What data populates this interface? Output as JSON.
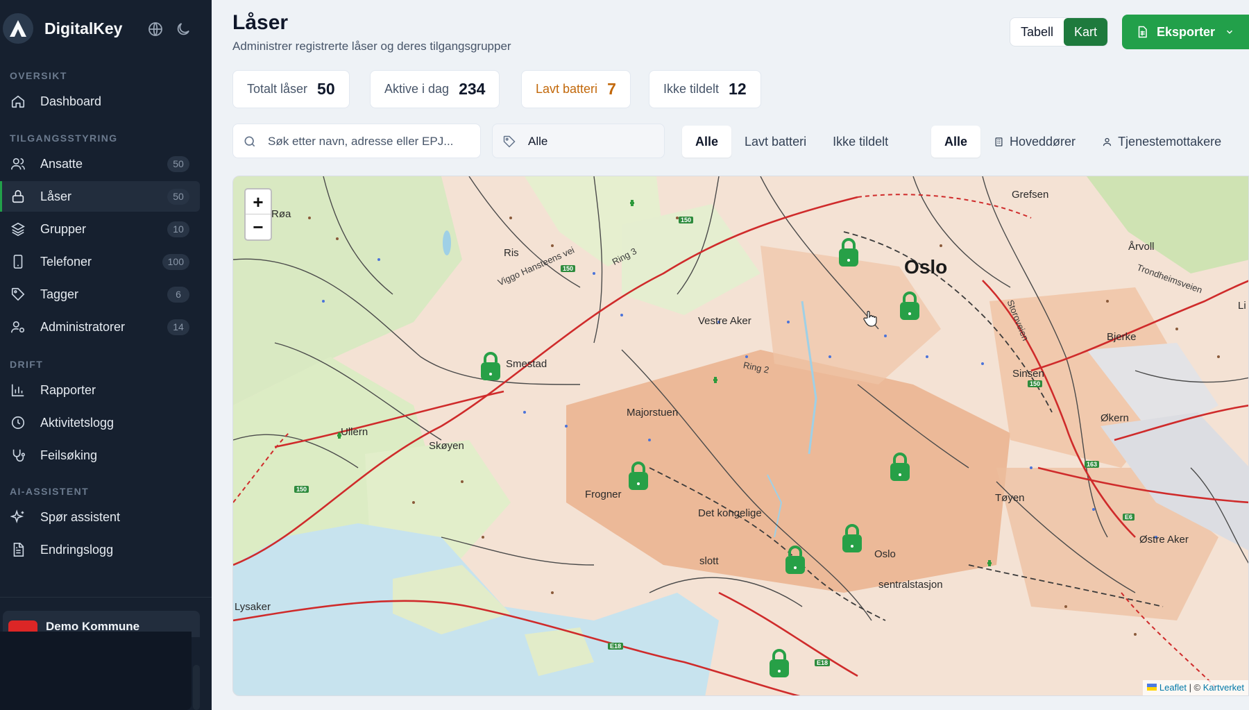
{
  "brand": {
    "name": "DigitalKey",
    "logo_letter": "A"
  },
  "colors": {
    "sidebar_bg": "#16202f",
    "accent_green": "#22a04a",
    "dark_green": "#1e7a3d",
    "warning": "#c2680a",
    "marker": "#27a047"
  },
  "sidebar": {
    "sections": [
      {
        "label": "OVERSIKT",
        "items": [
          {
            "label": "Dashboard",
            "icon": "home-icon",
            "badge": ""
          }
        ]
      },
      {
        "label": "TILGANGSSTYRING",
        "items": [
          {
            "label": "Ansatte",
            "icon": "users-icon",
            "badge": "50"
          },
          {
            "label": "Låser",
            "icon": "lock-icon",
            "badge": "50",
            "active": true
          },
          {
            "label": "Grupper",
            "icon": "layers-icon",
            "badge": "10"
          },
          {
            "label": "Telefoner",
            "icon": "phone-icon",
            "badge": "100"
          },
          {
            "label": "Tagger",
            "icon": "tag-icon",
            "badge": "6"
          },
          {
            "label": "Administratorer",
            "icon": "user-cog-icon",
            "badge": "14"
          }
        ]
      },
      {
        "label": "DRIFT",
        "items": [
          {
            "label": "Rapporter",
            "icon": "bar-chart-icon",
            "badge": ""
          },
          {
            "label": "Aktivitetslogg",
            "icon": "clock-icon",
            "badge": ""
          },
          {
            "label": "Feilsøking",
            "icon": "stethoscope-icon",
            "badge": ""
          }
        ]
      },
      {
        "label": "AI-ASSISTENT",
        "items": [
          {
            "label": "Spør assistent",
            "icon": "sparkles-icon",
            "badge": ""
          },
          {
            "label": "Endringslogg",
            "icon": "file-text-icon",
            "badge": ""
          }
        ]
      }
    ],
    "org": {
      "name": "Demo Kommune",
      "avatar": "DK"
    }
  },
  "header": {
    "title": "Låser",
    "subtitle": "Administrer registrerte låser og deres tilgangsgrupper",
    "view_toggle": {
      "table": "Tabell",
      "map": "Kart",
      "selected": "Kart"
    },
    "export_label": "Eksporter"
  },
  "stats": [
    {
      "label": "Totalt låser",
      "value": "50"
    },
    {
      "label": "Aktive i dag",
      "value": "234"
    },
    {
      "label": "Lavt batteri",
      "value": "7",
      "tone": "warning"
    },
    {
      "label": "Ikke tildelt",
      "value": "12"
    }
  ],
  "filters": {
    "search_placeholder": "Søk etter navn, adresse eller EPJ...",
    "tag_value": "Alle",
    "status": {
      "options": [
        "Alle",
        "Lavt batteri",
        "Ikke tildelt"
      ],
      "selected": "Alle"
    },
    "type": {
      "options": [
        "Alle",
        "Hoveddører",
        "Tjenestemottakere"
      ],
      "selected": "Alle"
    }
  },
  "map": {
    "zoom_in": "+",
    "zoom_out": "−",
    "attribution": {
      "leaflet": "Leaflet",
      "separator": " | © ",
      "provider": "Kartverket"
    },
    "places": [
      {
        "name": "Oslo",
        "kind": "city"
      },
      {
        "name": "Grefsen"
      },
      {
        "name": "Årvoll"
      },
      {
        "name": "Bjerke"
      },
      {
        "name": "Sinsen"
      },
      {
        "name": "Økern"
      },
      {
        "name": "Tøyen"
      },
      {
        "name": "Østre Aker"
      },
      {
        "name": "Vestre Aker"
      },
      {
        "name": "Smestad"
      },
      {
        "name": "Majorstuen"
      },
      {
        "name": "Frogner"
      },
      {
        "name": "Det kongelige"
      },
      {
        "name": "slott"
      },
      {
        "name": "Oslo"
      },
      {
        "name": "sentralstasjon"
      },
      {
        "name": "Skøyen"
      },
      {
        "name": "Ullern"
      },
      {
        "name": "Røa"
      },
      {
        "name": "Ris"
      },
      {
        "name": "Lysaker"
      },
      {
        "name": "Li"
      }
    ],
    "roads": [
      {
        "name": "Ring 3"
      },
      {
        "name": "Ring 2"
      },
      {
        "name": "Viggo Hansteens vei"
      },
      {
        "name": "Trondheimsveien"
      },
      {
        "name": "Storoveien"
      }
    ],
    "shields": [
      "150",
      "150",
      "150",
      "150",
      "E18",
      "E18",
      "163",
      "E6"
    ],
    "lock_count": 10
  }
}
